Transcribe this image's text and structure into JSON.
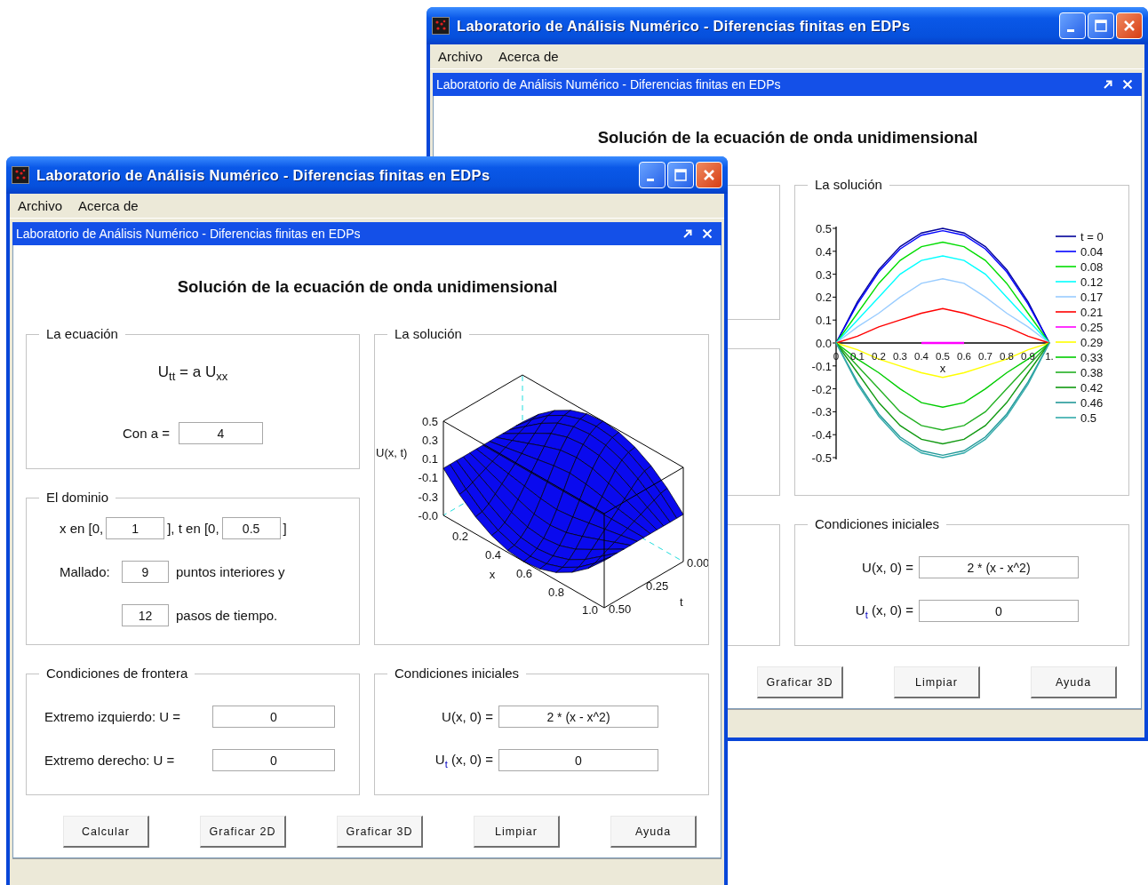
{
  "windows": [
    {
      "title": "Laboratorio de Análisis Numérico - Diferencias finitas en EDPs",
      "menu": [
        "Archivo",
        "Acerca de"
      ],
      "frame_title": "Laboratorio de Análisis Numérico - Diferencias finitas en EDPs",
      "heading": "Solución de la ecuación de onda unidimensional",
      "panels": [
        {
          "kind": "solution_2d",
          "title": "La solución",
          "chart_data": {
            "type": "line",
            "legend": "right",
            "xlabel": "x",
            "x": [
              0,
              0.1,
              0.2,
              0.3,
              0.4,
              0.5,
              0.6,
              0.7,
              0.8,
              0.9,
              1
            ],
            "xlim": [
              0,
              1
            ],
            "ylim": [
              -0.5,
              0.5
            ],
            "xticks": [
              {
                "value": 0,
                "label": "0"
              },
              {
                "value": 0.1,
                "label": "0.1"
              },
              {
                "value": 0.2,
                "label": "0.2"
              },
              {
                "value": 0.3,
                "label": "0.3"
              },
              {
                "value": 0.4,
                "label": "0.4"
              },
              {
                "value": 0.5,
                "label": "0.5"
              },
              {
                "value": 0.6,
                "label": "0.6"
              },
              {
                "value": 0.7,
                "label": "0.7"
              },
              {
                "value": 0.8,
                "label": "0.8"
              },
              {
                "value": 0.9,
                "label": "0.9"
              },
              {
                "value": 1,
                "label": "1."
              }
            ],
            "yticks": [
              {
                "value": 0.5,
                "label": "0.5"
              },
              {
                "value": 0.4,
                "label": "0.4"
              },
              {
                "value": 0.3,
                "label": "0.3"
              },
              {
                "value": 0.2,
                "label": "0.2"
              },
              {
                "value": 0.1,
                "label": "0.1"
              },
              {
                "value": 0,
                "label": "0.0"
              },
              {
                "value": -0.1,
                "label": "-0.1"
              },
              {
                "value": -0.2,
                "label": "-0.2"
              },
              {
                "value": -0.3,
                "label": "-0.3"
              },
              {
                "value": -0.4,
                "label": "-0.4"
              },
              {
                "value": -0.5,
                "label": "-0.5"
              }
            ],
            "series": [
              {
                "name": "t = 0",
                "color": "#000099",
                "values": [
                  0,
                  0.18,
                  0.32,
                  0.42,
                  0.48,
                  0.5,
                  0.48,
                  0.42,
                  0.32,
                  0.18,
                  0
                ]
              },
              {
                "name": "0.04",
                "color": "#0000ff",
                "values": [
                  0,
                  0.17,
                  0.31,
                  0.41,
                  0.47,
                  0.49,
                  0.47,
                  0.41,
                  0.31,
                  0.17,
                  0
                ]
              },
              {
                "name": "0.08",
                "color": "#00dd00",
                "values": [
                  0,
                  0.13,
                  0.26,
                  0.36,
                  0.42,
                  0.44,
                  0.42,
                  0.36,
                  0.26,
                  0.13,
                  0
                ]
              },
              {
                "name": "0.12",
                "color": "#00ffff",
                "values": [
                  0,
                  0.1,
                  0.2,
                  0.3,
                  0.36,
                  0.38,
                  0.36,
                  0.3,
                  0.2,
                  0.1,
                  0
                ]
              },
              {
                "name": "0.17",
                "color": "#99ccff",
                "values": [
                  0,
                  0.07,
                  0.13,
                  0.2,
                  0.26,
                  0.28,
                  0.26,
                  0.2,
                  0.13,
                  0.07,
                  0
                ]
              },
              {
                "name": "0.21",
                "color": "#ff0000",
                "values": [
                  0,
                  0.03,
                  0.07,
                  0.1,
                  0.13,
                  0.15,
                  0.13,
                  0.1,
                  0.07,
                  0.03,
                  0
                ]
              },
              {
                "name": "0.25",
                "color": "#ff00ff",
                "values": [
                  null,
                  null,
                  null,
                  null,
                  0,
                  0,
                  0,
                  null,
                  null,
                  null,
                  null
                ]
              },
              {
                "name": "0.29",
                "color": "#ffff00",
                "values": [
                  0,
                  -0.03,
                  -0.07,
                  -0.1,
                  -0.13,
                  -0.15,
                  -0.13,
                  -0.1,
                  -0.07,
                  -0.03,
                  0
                ]
              },
              {
                "name": "0.33",
                "color": "#00cc00",
                "values": [
                  0,
                  -0.07,
                  -0.13,
                  -0.2,
                  -0.26,
                  -0.28,
                  -0.26,
                  -0.2,
                  -0.13,
                  -0.07,
                  0
                ]
              },
              {
                "name": "0.38",
                "color": "#22b022",
                "values": [
                  0,
                  -0.1,
                  -0.2,
                  -0.3,
                  -0.36,
                  -0.38,
                  -0.36,
                  -0.3,
                  -0.2,
                  -0.1,
                  0
                ]
              },
              {
                "name": "0.42",
                "color": "#119911",
                "values": [
                  0,
                  -0.13,
                  -0.26,
                  -0.36,
                  -0.42,
                  -0.44,
                  -0.42,
                  -0.36,
                  -0.26,
                  -0.13,
                  0
                ]
              },
              {
                "name": "0.46",
                "color": "#229999",
                "values": [
                  0,
                  -0.17,
                  -0.31,
                  -0.41,
                  -0.47,
                  -0.49,
                  -0.47,
                  -0.41,
                  -0.31,
                  -0.17,
                  0
                ]
              },
              {
                "name": "0.5",
                "color": "#33aaaa",
                "values": [
                  0,
                  -0.18,
                  -0.32,
                  -0.42,
                  -0.48,
                  -0.5,
                  -0.48,
                  -0.42,
                  -0.32,
                  -0.18,
                  0
                ]
              }
            ]
          }
        },
        {
          "kind": "initial",
          "title": "Condiciones iniciales",
          "rows": [
            {
              "label": "U(x, 0) =",
              "value": "2 * (x - x^2)"
            },
            {
              "label": "U$_{t}$ (x, 0) =",
              "value": "0"
            }
          ]
        }
      ],
      "buttons": [
        "Graficar 3D",
        "Limpiar",
        "Ayuda"
      ]
    },
    {
      "title": "Laboratorio de Análisis Numérico - Diferencias finitas en EDPs",
      "menu": [
        "Archivo",
        "Acerca de"
      ],
      "frame_title": "Laboratorio de Análisis Numérico - Diferencias finitas en EDPs",
      "heading": "Solución de la ecuación de onda unidimensional",
      "panels": [
        {
          "kind": "equation",
          "title": "La ecuación",
          "formula": "U$_{tt}$ = a U$_{xx}$",
          "label": "Con a =",
          "value": "4"
        },
        {
          "kind": "solution_3d",
          "title": "La solución",
          "z_label": "U(x, t)",
          "z_ticks": [
            "0.5",
            "0.3",
            "0.1",
            "-0.1",
            "-0.3",
            "-0.0"
          ],
          "x_label": "x",
          "x_ticks": [
            "0.2",
            "0.4",
            "0.6",
            "0.8",
            "1.0"
          ],
          "t_label": "t",
          "t_ticks": [
            "0.00",
            "0.25",
            "0.50"
          ]
        },
        {
          "kind": "domain",
          "title": "El dominio",
          "x_prefix": "x en [0,",
          "x_value": "1",
          "t_prefix": "], t en [0,",
          "t_value": "0.5",
          "t_suffix": "]",
          "mesh_label": "Mallado:",
          "points_value": "9",
          "points_text": "puntos interiores y",
          "steps_value": "12",
          "steps_text": "pasos de tiempo."
        },
        {
          "kind": "boundary",
          "title": "Condiciones de frontera",
          "rows": [
            {
              "label": "Extremo izquierdo: U =",
              "value": "0"
            },
            {
              "label": "Extremo derecho:  U =",
              "value": "0"
            }
          ]
        },
        {
          "kind": "initial",
          "title": "Condiciones iniciales",
          "rows": [
            {
              "label": "U(x, 0) =",
              "value": "2 * (x - x^2)"
            },
            {
              "label": "U$_{t}$ (x, 0) =",
              "value": "0"
            }
          ]
        }
      ],
      "buttons": [
        "Calcular",
        "Graficar 2D",
        "Graficar 3D",
        "Limpiar",
        "Ayuda"
      ]
    }
  ]
}
